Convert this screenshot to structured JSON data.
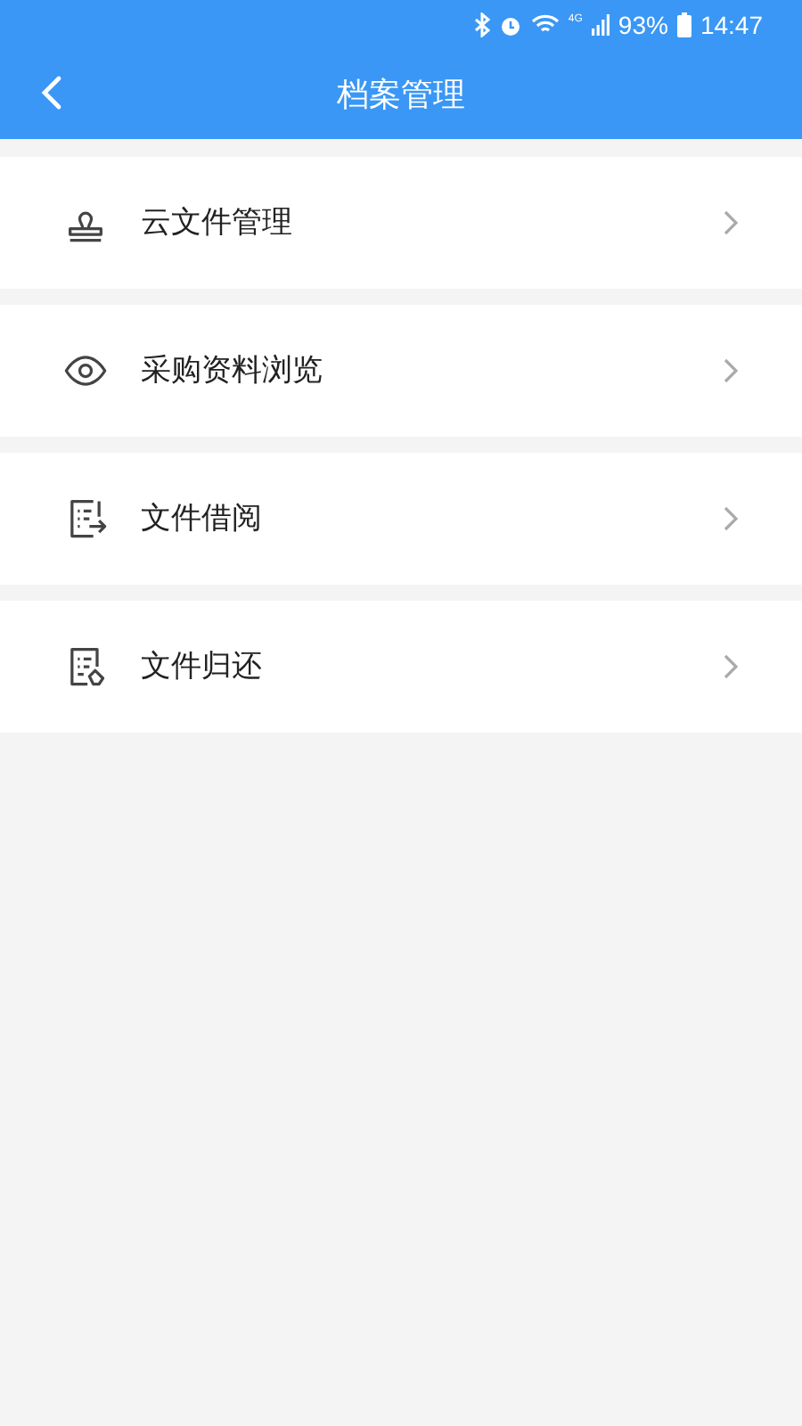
{
  "status_bar": {
    "network": "4G",
    "battery": "93%",
    "time": "14:47"
  },
  "header": {
    "title": "档案管理"
  },
  "items": [
    {
      "kind": "stamp",
      "label": "云文件管理"
    },
    {
      "kind": "eye",
      "label": "采购资料浏览"
    },
    {
      "kind": "borrow",
      "label": "文件借阅"
    },
    {
      "kind": "return",
      "label": "文件归还"
    }
  ]
}
